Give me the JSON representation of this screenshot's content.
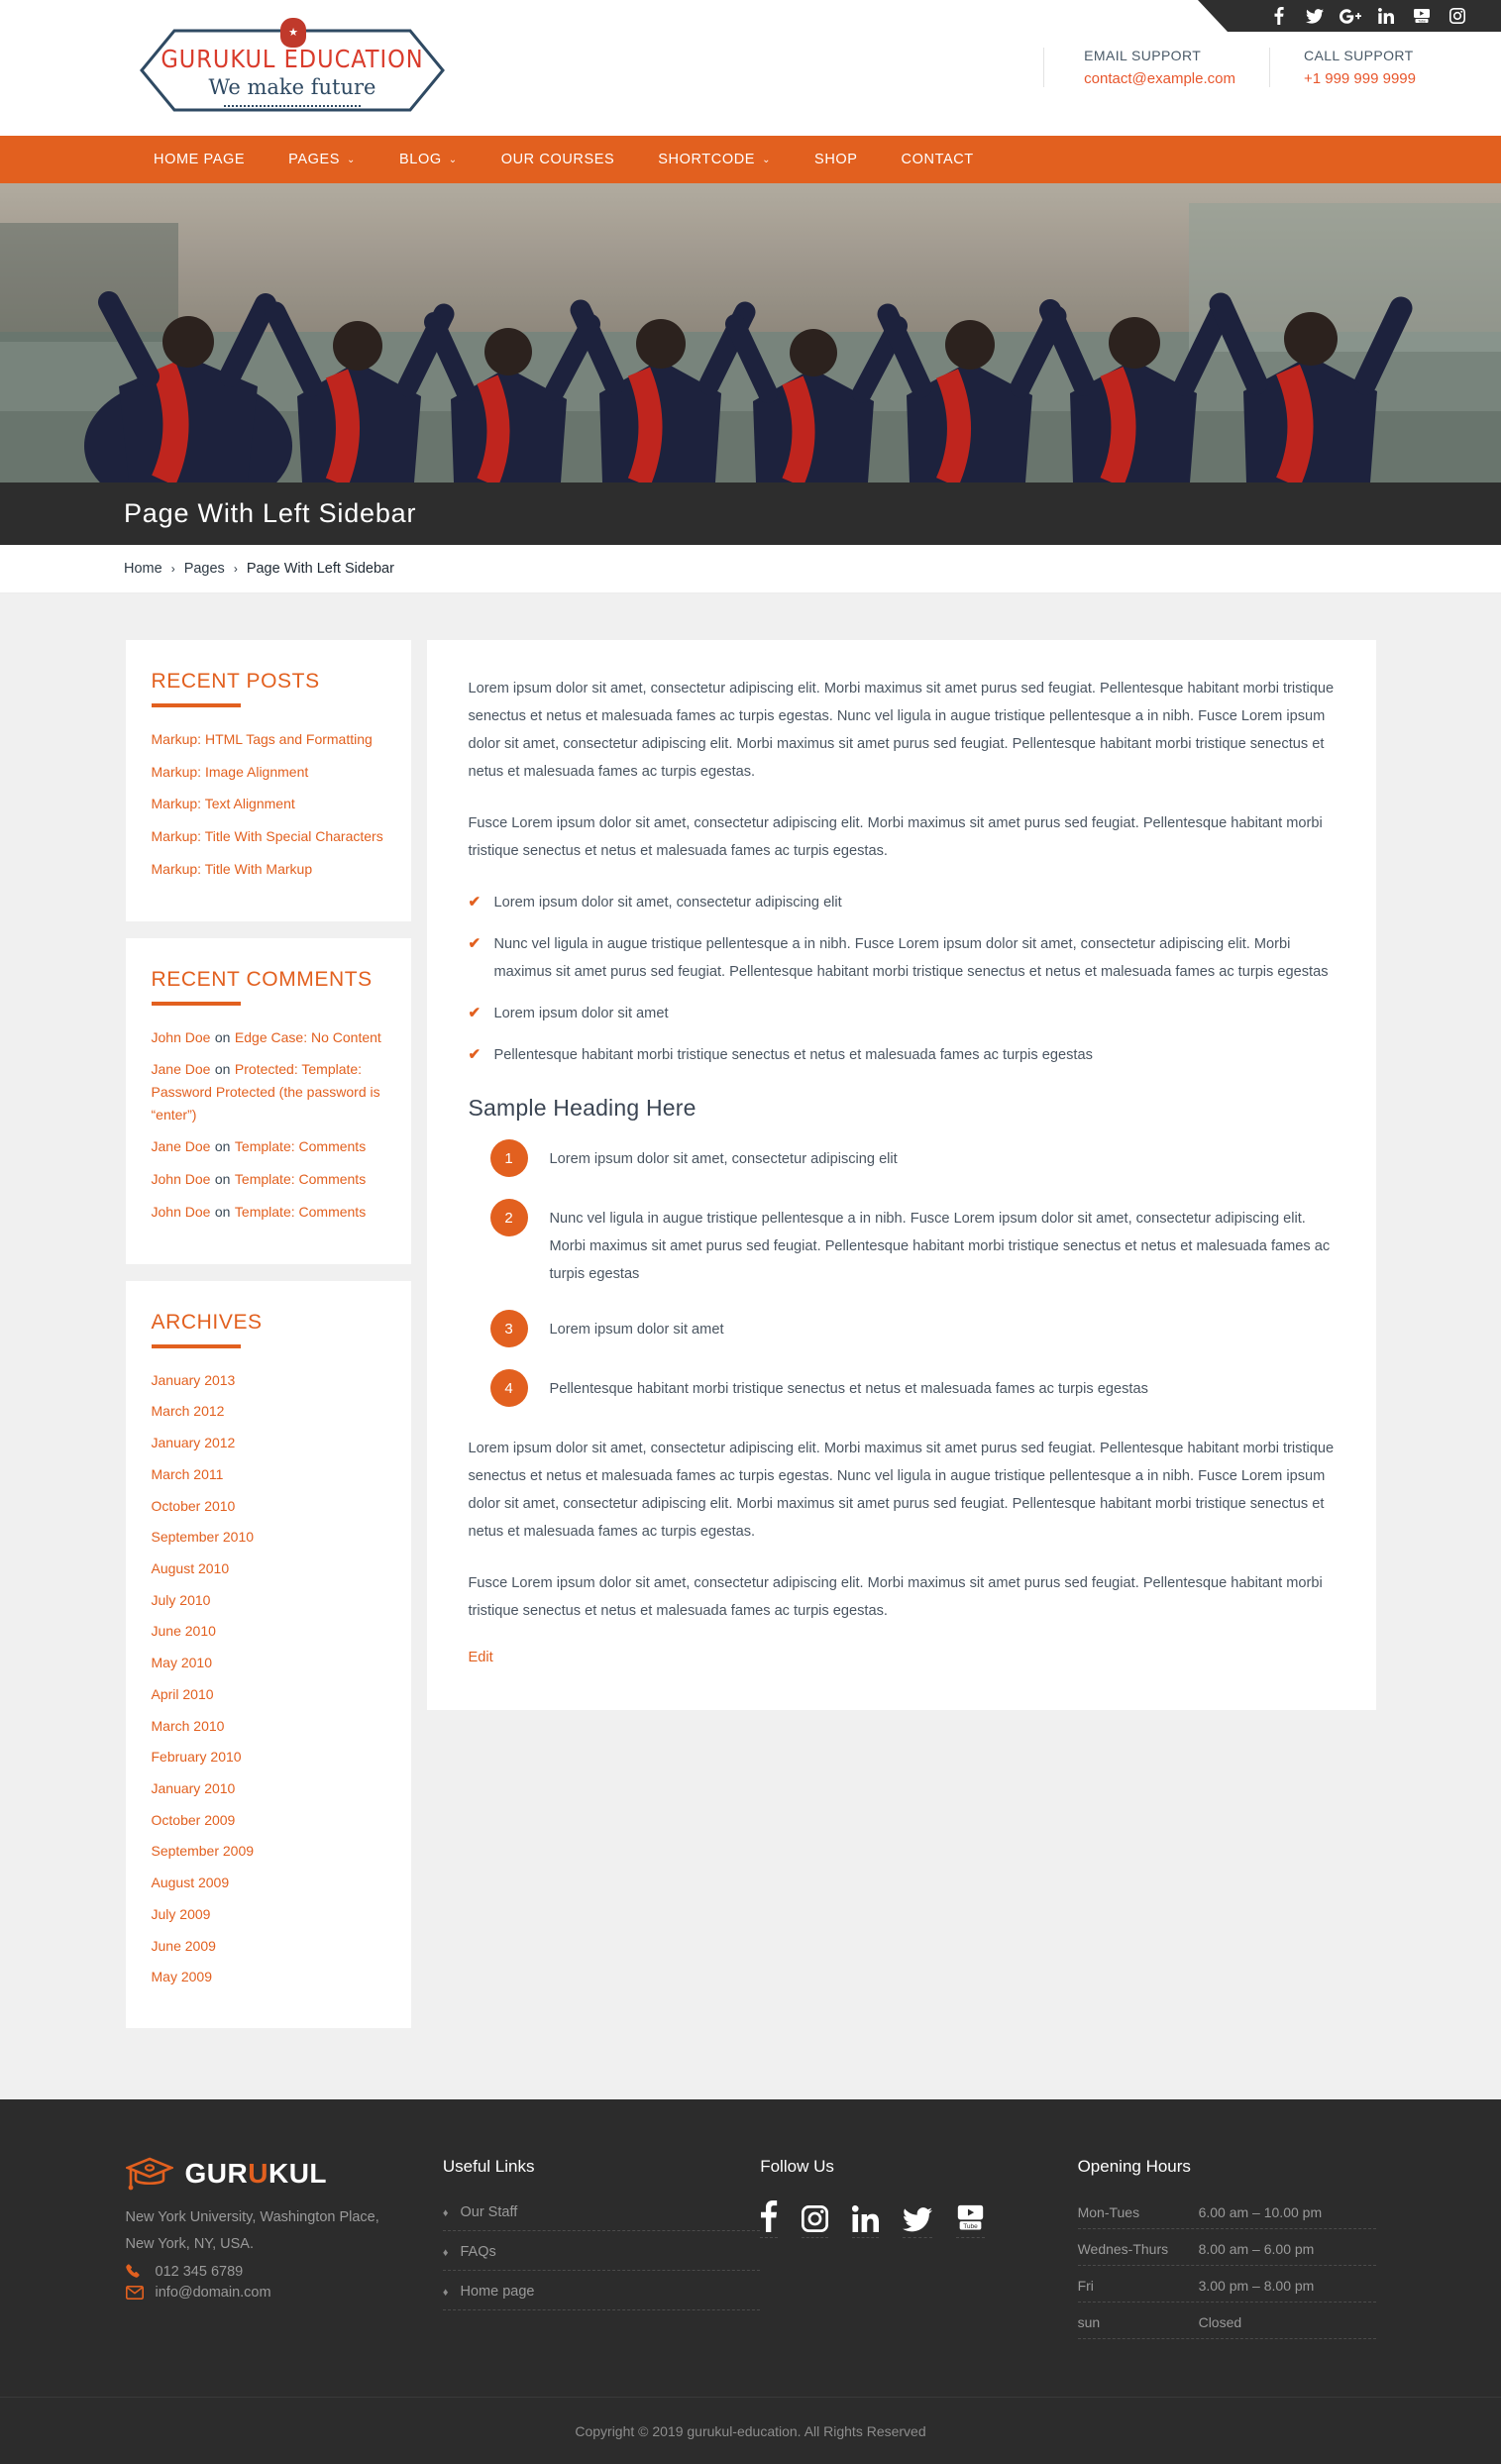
{
  "header": {
    "social": [
      {
        "name": "facebook",
        "label": "f"
      },
      {
        "name": "twitter",
        "label": "Twitter"
      },
      {
        "name": "google-plus",
        "label": "G+"
      },
      {
        "name": "linkedin",
        "label": "in"
      },
      {
        "name": "youtube",
        "label": "YouTube"
      },
      {
        "name": "instagram",
        "label": "Instagram"
      }
    ],
    "logo": {
      "name": "GURUKUL EDUCATION",
      "tagline": "We make future",
      "star": "★"
    },
    "contacts": [
      {
        "label": "EMAIL SUPPORT",
        "value": "contact@example.com"
      },
      {
        "label": "CALL SUPPORT",
        "value": "+1 999 999 9999"
      }
    ]
  },
  "nav": {
    "items": [
      {
        "label": "HOME PAGE",
        "caret": false
      },
      {
        "label": "PAGES",
        "caret": true
      },
      {
        "label": "BLOG",
        "caret": true
      },
      {
        "label": "OUR COURSES",
        "caret": false
      },
      {
        "label": "SHORTCODE",
        "caret": true
      },
      {
        "label": "SHOP",
        "caret": false
      },
      {
        "label": "CONTACT",
        "caret": false
      }
    ],
    "caret_glyph": "⌄"
  },
  "page": {
    "title": "Page With Left Sidebar",
    "breadcrumb": [
      {
        "label": "Home",
        "current": false
      },
      {
        "label": "Pages",
        "current": false
      },
      {
        "label": "Page With Left Sidebar",
        "current": true
      }
    ],
    "breadcrumb_separator": "›"
  },
  "sidebar": {
    "recent_posts": {
      "title": "RECENT POSTS",
      "items": [
        "Markup: HTML Tags and Formatting",
        "Markup: Image Alignment",
        "Markup: Text Alignment",
        "Markup: Title With Special Characters",
        "Markup: Title With Markup"
      ]
    },
    "recent_comments": {
      "title": "RECENT COMMENTS",
      "items": [
        {
          "author": "John Doe",
          "on": "on",
          "post": "Edge Case: No Content"
        },
        {
          "author": "Jane Doe",
          "on": "on",
          "post": "Protected: Template: Password Protected (the password is “enter”)"
        },
        {
          "author": "Jane Doe",
          "on": "on",
          "post": "Template: Comments"
        },
        {
          "author": "John Doe",
          "on": "on",
          "post": "Template: Comments"
        },
        {
          "author": "John Doe",
          "on": "on",
          "post": "Template: Comments"
        }
      ]
    },
    "archives": {
      "title": "ARCHIVES",
      "items": [
        "January 2013",
        "March 2012",
        "January 2012",
        "March 2011",
        "October 2010",
        "September 2010",
        "August 2010",
        "July 2010",
        "June 2010",
        "May 2010",
        "April 2010",
        "March 2010",
        "February 2010",
        "January 2010",
        "October 2009",
        "September 2009",
        "August 2009",
        "July 2009",
        "June 2009",
        "May 2009"
      ]
    }
  },
  "main": {
    "paragraph1": "Lorem ipsum dolor sit amet, consectetur adipiscing elit. Morbi maximus sit amet purus sed feugiat. Pellentesque habitant morbi tristique senectus et netus et malesuada fames ac turpis egestas. Nunc vel ligula in augue tristique pellentesque a in nibh. Fusce Lorem ipsum dolor sit amet, consectetur adipiscing elit. Morbi maximus sit amet purus sed feugiat. Pellentesque habitant morbi tristique senectus et netus et malesuada fames ac turpis egestas.",
    "paragraph2": "Fusce Lorem ipsum dolor sit amet, consectetur adipiscing elit. Morbi maximus sit amet purus sed feugiat. Pellentesque habitant morbi tristique senectus et netus et malesuada fames ac turpis egestas.",
    "check_glyph": "✔",
    "check_items": [
      "Lorem ipsum dolor sit amet, consectetur adipiscing elit",
      "Nunc vel ligula in augue tristique pellentesque a in nibh. Fusce Lorem ipsum dolor sit amet, consectetur adipiscing elit. Morbi maximus sit amet purus sed feugiat. Pellentesque habitant morbi tristique senectus et netus et malesuada fames ac turpis egestas",
      "Lorem ipsum dolor sit amet",
      "Pellentesque habitant morbi tristique senectus et netus et malesuada fames ac turpis egestas"
    ],
    "heading": "Sample Heading Here",
    "numbered_items": [
      {
        "num": "1",
        "text": "Lorem ipsum dolor sit amet, consectetur adipiscing elit"
      },
      {
        "num": "2",
        "text": "Nunc vel ligula in augue tristique pellentesque a in nibh. Fusce Lorem ipsum dolor sit amet, consectetur adipiscing elit. Morbi maximus sit amet purus sed feugiat. Pellentesque habitant morbi tristique senectus et netus et malesuada fames ac turpis egestas"
      },
      {
        "num": "3",
        "text": "Lorem ipsum dolor sit amet"
      },
      {
        "num": "4",
        "text": "Pellentesque habitant morbi tristique senectus et netus et malesuada fames ac turpis egestas"
      }
    ],
    "paragraph3": "Lorem ipsum dolor sit amet, consectetur adipiscing elit. Morbi maximus sit amet purus sed feugiat. Pellentesque habitant morbi tristique senectus et netus et malesuada fames ac turpis egestas. Nunc vel ligula in augue tristique pellentesque a in nibh. Fusce Lorem ipsum dolor sit amet, consectetur adipiscing elit. Morbi maximus sit amet purus sed feugiat. Pellentesque habitant morbi tristique senectus et netus et malesuada fames ac turpis egestas.",
    "paragraph4": "Fusce Lorem ipsum dolor sit amet, consectetur adipiscing elit. Morbi maximus sit amet purus sed feugiat. Pellentesque habitant morbi tristique senectus et netus et malesuada fames ac turpis egestas.",
    "edit_label": "Edit"
  },
  "footer": {
    "brand": {
      "prefix": "GUR",
      "accent": "U",
      "suffix": "KUL"
    },
    "address_line1": "New York University, Washington Place,",
    "address_line2": "New York, NY, USA.",
    "phone": "012 345 6789",
    "email": "info@domain.com",
    "useful_links": {
      "title": "Useful Links",
      "bullet": "♦",
      "items": [
        "Our Staff",
        "FAQs",
        "Home page"
      ]
    },
    "follow": {
      "title": "Follow Us",
      "items": [
        {
          "name": "facebook"
        },
        {
          "name": "instagram"
        },
        {
          "name": "linkedin"
        },
        {
          "name": "twitter"
        },
        {
          "name": "youtube"
        }
      ]
    },
    "hours": {
      "title": "Opening Hours",
      "rows": [
        {
          "day": "Mon-Tues",
          "time": "6.00 am – 10.00 pm"
        },
        {
          "day": "Wednes-Thurs",
          "time": "8.00 am – 6.00 pm"
        },
        {
          "day": "Fri",
          "time": "3.00 pm – 8.00 pm"
        },
        {
          "day": "sun",
          "time": "Closed"
        }
      ]
    },
    "copyright": "Copyright © 2019 gurukul-education. All Rights Reserved"
  },
  "colors": {
    "accent": "#e2601f",
    "dark": "#2c2c2c",
    "logo_red": "#d93b2b",
    "logo_navy": "#2f4a63"
  }
}
